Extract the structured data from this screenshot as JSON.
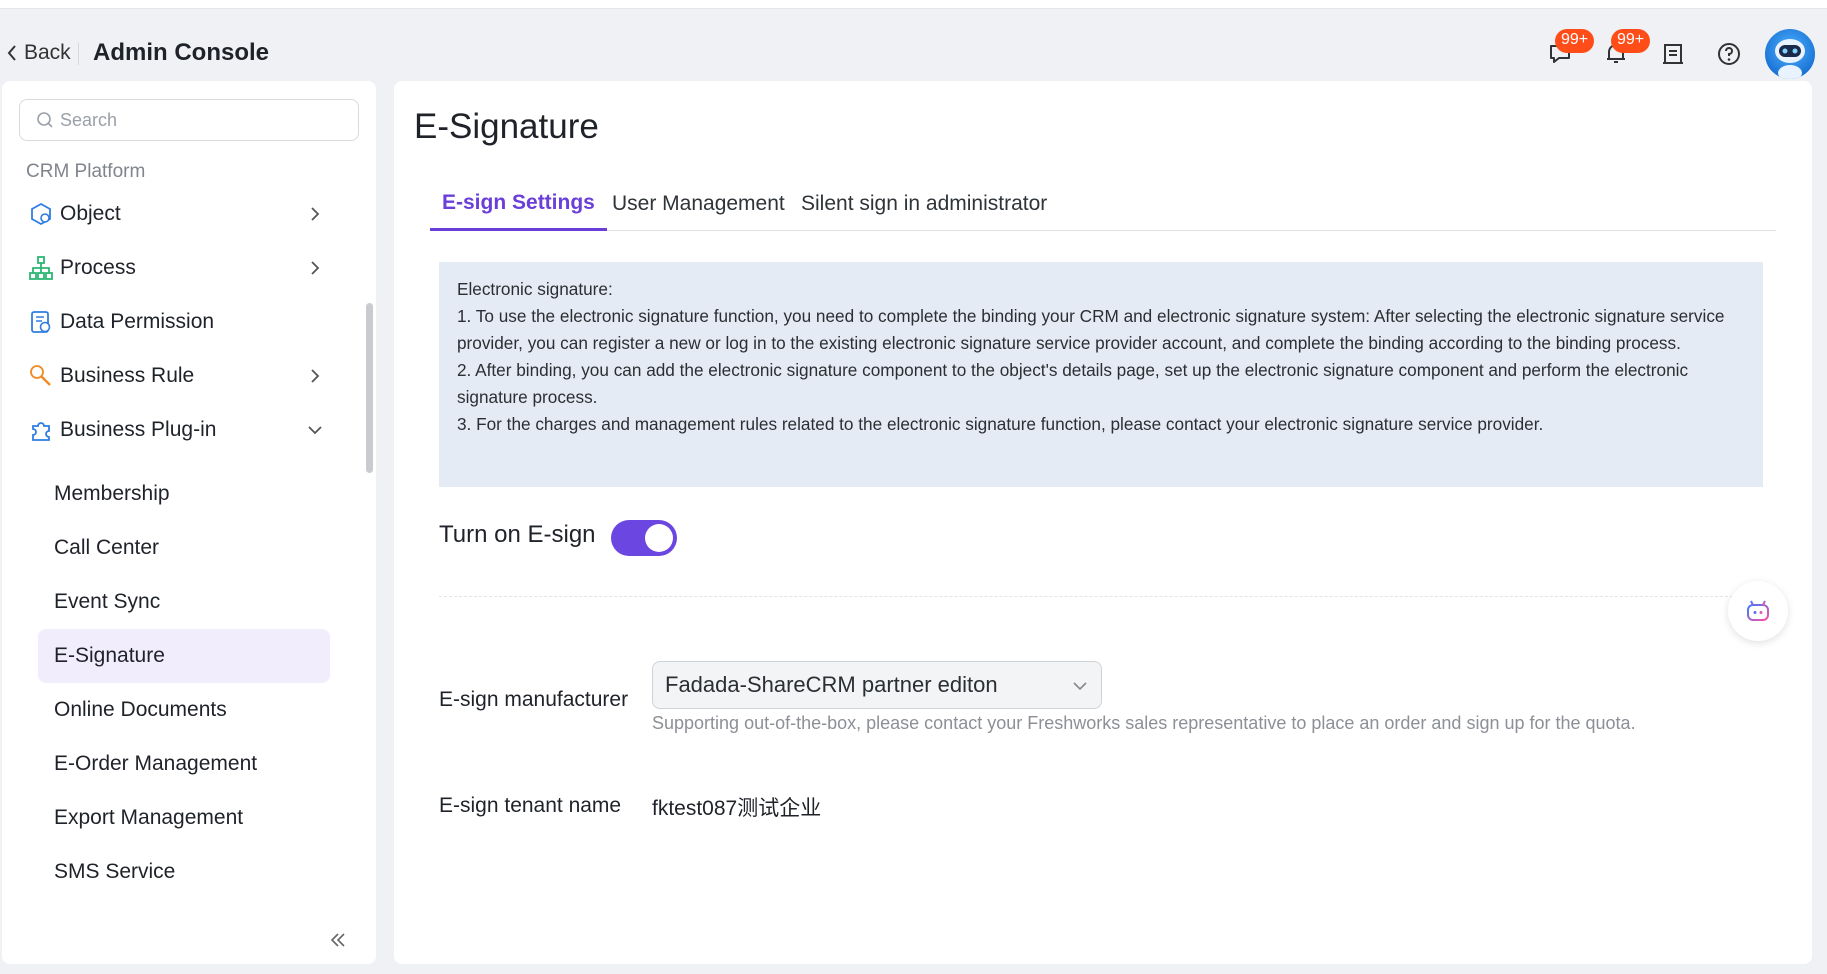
{
  "header": {
    "back_label": "Back",
    "title": "Admin Console",
    "messages_badge": "99+",
    "notifications_badge": "99+"
  },
  "sidebar": {
    "search_placeholder": "Search",
    "section_label": "CRM Platform",
    "items": [
      {
        "label": "Object",
        "icon": "object-icon"
      },
      {
        "label": "Process",
        "icon": "process-icon"
      },
      {
        "label": "Data Permission",
        "icon": "data-permission-icon"
      },
      {
        "label": "Business Rule",
        "icon": "business-rule-icon"
      },
      {
        "label": "Business Plug-in",
        "icon": "plugin-icon"
      }
    ],
    "sub_items": [
      {
        "label": "Membership"
      },
      {
        "label": "Call Center"
      },
      {
        "label": "Event Sync"
      },
      {
        "label": "E-Signature",
        "active": true
      },
      {
        "label": "Online Documents"
      },
      {
        "label": "E-Order Management"
      },
      {
        "label": "Export Management"
      },
      {
        "label": "SMS Service"
      }
    ]
  },
  "main": {
    "page_title": "E-Signature",
    "tabs": [
      {
        "label": "E-sign Settings",
        "active": true
      },
      {
        "label": "User Management"
      },
      {
        "label": "Silent sign in administrator"
      }
    ],
    "notice": {
      "heading": "Electronic signature:",
      "lines": [
        "1. To use the electronic signature function, you need to complete the binding your CRM and electronic signature system: After selecting the electronic signature service provider, you can register a new or log in to the existing electronic signature service provider account, and complete the binding according to the binding process.",
        "2. After binding, you can add the electronic signature component to the object's details page, set up the electronic signature component and perform the electronic signature process.",
        "3. For the charges and management rules related to the electronic signature function, please contact your electronic signature service provider."
      ]
    },
    "toggle_label": "Turn on E-sign",
    "toggle_on": true,
    "manufacturer_label": "E-sign manufacturer",
    "manufacturer_value": "Fadada-ShareCRM partner editon",
    "manufacturer_hint": "Supporting out-of-the-box, please contact your Freshworks sales representative to place an order and sign up for the quota.",
    "tenant_label": "E-sign tenant name",
    "tenant_value": "fktest087测试企业"
  },
  "colors": {
    "accent": "#6a3fd9",
    "badge": "#ff4d1a",
    "notice_bg": "#e4ebf5",
    "active_bg": "#f1edfd"
  }
}
